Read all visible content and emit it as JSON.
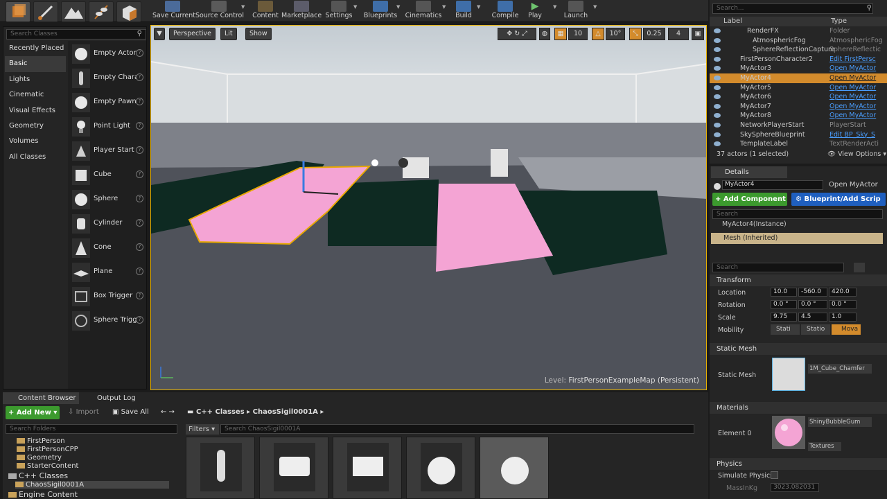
{
  "toolbar": {
    "save_current": "Save Current",
    "source_control": "Source Control",
    "content": "Content",
    "marketplace": "Marketplace",
    "settings": "Settings",
    "blueprints": "Blueprints",
    "cinematics": "Cinematics",
    "build": "Build",
    "compile": "Compile",
    "play": "Play",
    "launch": "Launch"
  },
  "modes": {
    "search_placeholder": "Search Classes",
    "categories": [
      "Recently Placed",
      "Basic",
      "Lights",
      "Cinematic",
      "Visual Effects",
      "Geometry",
      "Volumes",
      "All Classes"
    ],
    "items": [
      "Empty Actor",
      "Empty Charac",
      "Empty Pawn",
      "Point Light",
      "Player Start",
      "Cube",
      "Sphere",
      "Cylinder",
      "Cone",
      "Plane",
      "Box Trigger",
      "Sphere Trigge"
    ]
  },
  "viewport": {
    "perspective": "Perspective",
    "lit": "Lit",
    "show": "Show",
    "grid_snap": "10",
    "rot_snap": "10°",
    "scale_snap": "0.25",
    "cam_speed": "4",
    "level_label": "Level:",
    "level_name": "FirstPersonExampleMap (Persistent)"
  },
  "outliner": {
    "search_placeholder": "Search...",
    "col_label": "Label",
    "col_type": "Type",
    "rows": [
      {
        "label": "RenderFX",
        "type": "Folder",
        "link": false
      },
      {
        "label": "AtmosphericFog",
        "type": "AtmosphericFog",
        "link": false
      },
      {
        "label": "SphereReflectionCapture",
        "type": "SphereReflectic",
        "link": false
      },
      {
        "label": "FirstPersonCharacter2",
        "type": "Edit FirstPersc",
        "link": true
      },
      {
        "label": "MyActor3",
        "type": "Open MyActor",
        "link": true
      },
      {
        "label": "MyActor4",
        "type": "Open MyActor",
        "link": true
      },
      {
        "label": "MyActor5",
        "type": "Open MyActor",
        "link": true
      },
      {
        "label": "MyActor6",
        "type": "Open MyActor",
        "link": true
      },
      {
        "label": "MyActor7",
        "type": "Open MyActor",
        "link": true
      },
      {
        "label": "MyActor8",
        "type": "Open MyActor",
        "link": true
      },
      {
        "label": "NetworkPlayerStart",
        "type": "PlayerStart",
        "link": false
      },
      {
        "label": "SkySphereBlueprint",
        "type": "Edit BP_Sky_S",
        "link": true
      },
      {
        "label": "TemplateLabel",
        "type": "TextRenderActi",
        "link": false
      }
    ],
    "status": "37 actors (1 selected)",
    "view_options": "View Options"
  },
  "details": {
    "tab": "Details",
    "actor_name": "MyActor4",
    "open_link": "Open MyActor",
    "add_component": "+ Add Component",
    "blueprint_script": "Blueprint/Add Scrip",
    "search_placeholder": "Search",
    "instance": "MyActor4(Instance)",
    "mesh_inherited": "Mesh (Inherited)",
    "search2_placeholder": "Search",
    "transform": "Transform",
    "location_label": "Location",
    "location": [
      "10.0",
      "-560.0",
      "420.0"
    ],
    "rotation_label": "Rotation",
    "rotation": [
      "0.0 °",
      "0.0 °",
      "0.0 °"
    ],
    "scale_label": "Scale",
    "scale": [
      "9.75",
      "4.5",
      "1.0"
    ],
    "mobility_label": "Mobility",
    "mobility_options": [
      "Stati",
      "Statio",
      "Mova"
    ],
    "static_mesh_section": "Static Mesh",
    "static_mesh_label": "Static Mesh",
    "static_mesh_value": "1M_Cube_Chamfer",
    "materials_section": "Materials",
    "element0_label": "Element 0",
    "element0_value": "ShinyBubbleGum",
    "textures": "Textures",
    "physics_section": "Physics",
    "simulate_physics": "Simulate Physics",
    "mass_label": "MassInKg",
    "mass_value": "3023.082031"
  },
  "content_browser": {
    "tab_content": "Content Browser",
    "tab_output": "Output Log",
    "add_new": "Add New",
    "import": "Import",
    "save_all": "Save All",
    "path": [
      "C++ Classes",
      "ChaosSigil0001A"
    ],
    "folder_search": "Search Folders",
    "filters": "Filters",
    "asset_search": "Search ChaosSigil0001A",
    "tree": [
      "FirstPerson",
      "FirstPersonCPP",
      "Geometry",
      "StarterContent",
      "C++ Classes",
      "ChaosSigil0001A",
      "Engine Content"
    ]
  },
  "colors": {
    "selection_orange": "#d38b2c",
    "link_blue": "#4a9eff",
    "add_green": "#3c9a2e",
    "blueprint_blue": "#1f5fbf",
    "pink": "#f4a4d4"
  }
}
